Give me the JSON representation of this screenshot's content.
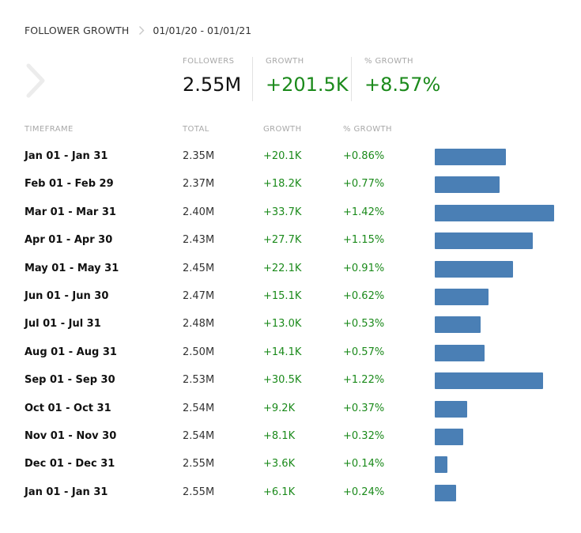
{
  "header": {
    "title": "FOLLOWER GROWTH",
    "date_range": "01/01/20 - 01/01/21"
  },
  "summary": {
    "followers_label": "FOLLOWERS",
    "followers_value": "2.55M",
    "growth_label": "GROWTH",
    "growth_value": "+201.5K",
    "pct_growth_label": "% GROWTH",
    "pct_growth_value": "+8.57%"
  },
  "table": {
    "headers": {
      "timeframe": "TIMEFRAME",
      "total": "TOTAL",
      "growth": "GROWTH",
      "pct_growth": "% GROWTH"
    },
    "rows": [
      {
        "timeframe": "Jan 01 - Jan 31",
        "total": "2.35M",
        "growth": "+20.1K",
        "pct": "+0.86%",
        "bar": 20.1
      },
      {
        "timeframe": "Feb 01 - Feb 29",
        "total": "2.37M",
        "growth": "+18.2K",
        "pct": "+0.77%",
        "bar": 18.2
      },
      {
        "timeframe": "Mar 01 - Mar 31",
        "total": "2.40M",
        "growth": "+33.7K",
        "pct": "+1.42%",
        "bar": 33.7
      },
      {
        "timeframe": "Apr 01 - Apr 30",
        "total": "2.43M",
        "growth": "+27.7K",
        "pct": "+1.15%",
        "bar": 27.7
      },
      {
        "timeframe": "May 01 - May 31",
        "total": "2.45M",
        "growth": "+22.1K",
        "pct": "+0.91%",
        "bar": 22.1
      },
      {
        "timeframe": "Jun 01 - Jun 30",
        "total": "2.47M",
        "growth": "+15.1K",
        "pct": "+0.62%",
        "bar": 15.1
      },
      {
        "timeframe": "Jul 01 - Jul 31",
        "total": "2.48M",
        "growth": "+13.0K",
        "pct": "+0.53%",
        "bar": 13.0
      },
      {
        "timeframe": "Aug 01 - Aug 31",
        "total": "2.50M",
        "growth": "+14.1K",
        "pct": "+0.57%",
        "bar": 14.1
      },
      {
        "timeframe": "Sep 01 - Sep 30",
        "total": "2.53M",
        "growth": "+30.5K",
        "pct": "+1.22%",
        "bar": 30.5
      },
      {
        "timeframe": "Oct 01 - Oct 31",
        "total": "2.54M",
        "growth": "+9.2K",
        "pct": "+0.37%",
        "bar": 9.2
      },
      {
        "timeframe": "Nov 01 - Nov 30",
        "total": "2.54M",
        "growth": "+8.1K",
        "pct": "+0.32%",
        "bar": 8.1
      },
      {
        "timeframe": "Dec 01 - Dec 31",
        "total": "2.55M",
        "growth": "+3.6K",
        "pct": "+0.14%",
        "bar": 3.6
      },
      {
        "timeframe": "Jan 01 - Jan 31",
        "total": "2.55M",
        "growth": "+6.1K",
        "pct": "+0.24%",
        "bar": 6.1
      }
    ]
  },
  "colors": {
    "bar": "#4a7fb5",
    "positive": "#1b8a1b",
    "muted_label": "#a8a8a8"
  },
  "icons": {
    "breadcrumb_separator": "chevron-right-icon",
    "nav": "chevron-right-icon"
  }
}
